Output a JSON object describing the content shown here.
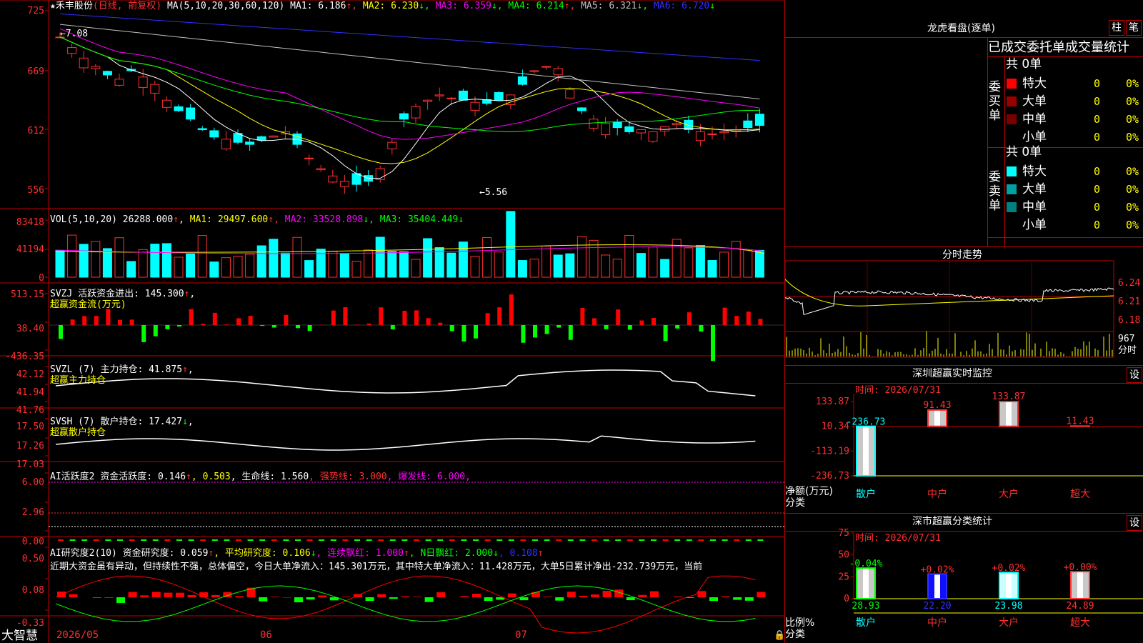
{
  "stock": {
    "name": "★禾丰股份",
    "mode": "(日线, 前复权)"
  },
  "ma_header": {
    "prefix": "MA(5,10,20,30,60,120)",
    "items": [
      {
        "label": "MA1: 6.186",
        "arrow": "↑",
        "color": "#ffffff"
      },
      {
        "label": "MA2: 6.230",
        "arrow": "↓",
        "color": "#ffff00"
      },
      {
        "label": "MA3: 6.359",
        "arrow": "↓",
        "color": "#ff00ff"
      },
      {
        "label": "MA4: 6.214",
        "arrow": "↑",
        "color": "#00ff00"
      },
      {
        "label": "MA5: 6.321",
        "arrow": "↓",
        "color": "#c0c0c0"
      },
      {
        "label": "MA6: 6.720",
        "arrow": "↓",
        "color": "#3030ff"
      }
    ],
    "max_marker": "7.08",
    "min_marker": "5.56"
  },
  "price_axis": [
    "725",
    "669",
    "612",
    "556"
  ],
  "vol_header": {
    "prefix": "VOL(5,10,20)",
    "value": "26288.000",
    "arrow": "↑",
    "items": [
      {
        "label": "MA1: 29497.600",
        "arrow": "↑",
        "color": "#ffff00"
      },
      {
        "label": "MA2: 33528.898",
        "arrow": "↓",
        "color": "#ff00ff"
      },
      {
        "label": "MA3: 35404.449",
        "arrow": "↓",
        "color": "#00ff00"
      }
    ]
  },
  "vol_axis": [
    "83418",
    "41194",
    "0"
  ],
  "svzj": {
    "line1": "SVZJ  活跃资金进出: 145.300",
    "arrow": "↑",
    "line2": "超赢资金流(万元)",
    "axis": [
      "513.15",
      "38.40",
      "-436.35"
    ]
  },
  "svzl": {
    "line1": "SVZL (7) 主力持仓: 41.875",
    "arrow": "↑",
    "line2": "超赢主力持仓",
    "axis": [
      "42.12",
      "41.94",
      "41.76"
    ]
  },
  "svsh": {
    "line1": "SVSH (7) 散户持仓: 17.427",
    "arrow": "↓",
    "line2": "超赢散户持仓",
    "axis": [
      "17.50",
      "17.26",
      "17.03"
    ]
  },
  "ai1": {
    "prefix": "AI活跃度2 资金活跃度: 0.146",
    "a1": "↑",
    "v2": ", 0.503",
    "v3": ", 生命线: 1.560",
    "v4": ", 强势线: 3.000",
    "v5": ", 爆发线: 6.000",
    "end": ",",
    "axis": [
      "6.00",
      "2.96",
      "0.00"
    ]
  },
  "ai2": {
    "prefix": "AI研究度2(10) 资金研究度: 0.059",
    "a1": "↑",
    "v2": ", 平均研究度: 0.106",
    "a2": "↓",
    "v3": ", 连续飘红: 1.000",
    "a3": "↑",
    "v4": ", N日飘红: 2.000",
    "a4": "↓",
    "v5": ", 0.108",
    "a5": "↑",
    "comment": "近期大资金虽有异动，但持续性不强，总体偏空，今日大单净流入：145.301万元，其中特大单净流入：11.428万元，大单5日累计净出-232.739万元，当前",
    "axis": [
      "0.50",
      "0.08",
      "-0.33"
    ]
  },
  "bottom": {
    "brand": "大智慧",
    "dates": [
      "2026/05",
      "06",
      "07"
    ]
  },
  "lhb": {
    "title": "龙虎看盘(逐单)",
    "btn1": "柱",
    "btn2": "笔",
    "subtitle": "已成交委托单成交量统计",
    "buy": {
      "side": "委买单",
      "total": "共 0单",
      "rows": [
        {
          "name": "特大",
          "count": "0",
          "pct": "0%",
          "color": "#ff0000"
        },
        {
          "name": "大单",
          "count": "0",
          "pct": "0%",
          "color": "#990000"
        },
        {
          "name": "中单",
          "count": "0",
          "pct": "0%",
          "color": "#7a0000"
        },
        {
          "name": "小单",
          "count": "0",
          "pct": "0%",
          "color": "#000000"
        }
      ]
    },
    "sell": {
      "side": "委卖单",
      "total": "共 0单",
      "rows": [
        {
          "name": "特大",
          "count": "0",
          "pct": "0%",
          "color": "#00ffff"
        },
        {
          "name": "大单",
          "count": "0",
          "pct": "0%",
          "color": "#00a0a0"
        },
        {
          "name": "中单",
          "count": "0",
          "pct": "0%",
          "color": "#008080"
        },
        {
          "name": "小单",
          "count": "0",
          "pct": "0%",
          "color": "#000000"
        }
      ]
    }
  },
  "intraday": {
    "title": "分时走势",
    "axis": [
      "6.24",
      "6.21",
      "6.18"
    ],
    "vol_max": "967",
    "vol_label": "分时"
  },
  "monitor": {
    "title": "深圳超赢实时监控",
    "btn": "设",
    "time": "时间: 2026/07/31",
    "axis": [
      "133.87",
      "10.34",
      "-113.19",
      "-236.73"
    ],
    "ylabel1": "净额(万元)",
    "ylabel2": "分类",
    "bars": [
      {
        "cat": "散户",
        "value": -236.73,
        "label": "-236.73"
      },
      {
        "cat": "中户",
        "value": 91.43,
        "label": "91.43"
      },
      {
        "cat": "大户",
        "value": 133.87,
        "label": "133.87"
      },
      {
        "cat": "超大",
        "value": 11.43,
        "label": "11.43"
      }
    ]
  },
  "classify": {
    "title": "深市超赢分类统计",
    "btn": "设",
    "time": "时间: 2026/07/31",
    "axis": [
      "75",
      "50",
      "25",
      "0"
    ],
    "ylabel1": "比例%",
    "ylabel2": "分类",
    "bars": [
      {
        "cat": "散户",
        "pct": 28.93,
        "label": "28.93",
        "chg": "-0.04%"
      },
      {
        "cat": "中户",
        "pct": 22.2,
        "label": "22.20",
        "chg": "+0.02%"
      },
      {
        "cat": "大户",
        "pct": 23.98,
        "label": "23.98",
        "chg": "+0.02%"
      },
      {
        "cat": "超大",
        "pct": 24.89,
        "label": "24.89",
        "chg": "+0.00%"
      }
    ]
  }
}
